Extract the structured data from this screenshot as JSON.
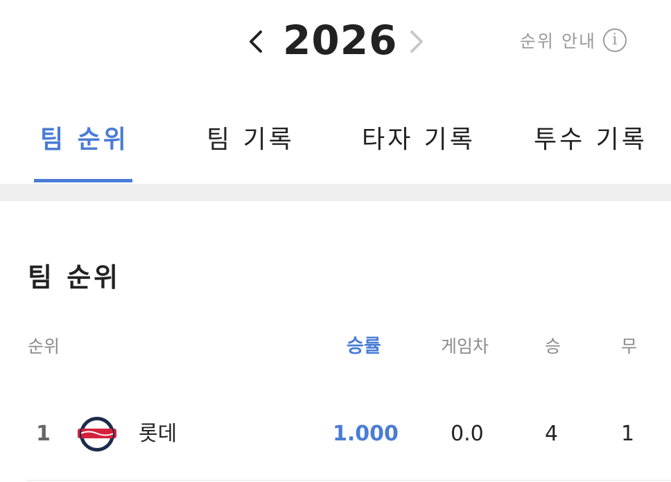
{
  "season": {
    "year": "2026",
    "prev_icon": "chevron-left-icon",
    "next_icon": "chevron-right-icon",
    "guide_label": "순위 안내",
    "guide_icon_glyph": "i"
  },
  "tabs": [
    {
      "label": "팀 순위",
      "active": true
    },
    {
      "label": "팀 기록",
      "active": false
    },
    {
      "label": "타자 기록",
      "active": false
    },
    {
      "label": "투수 기록",
      "active": false
    }
  ],
  "section": {
    "title": "팀 순위"
  },
  "table": {
    "columns": {
      "rank": "순위",
      "win_rate": "승률",
      "games_behind": "게임차",
      "wins": "승",
      "draws": "무"
    },
    "sorted_column": "win_rate",
    "rows": [
      {
        "rank": "1",
        "team": "롯데",
        "logo": "giants-logo",
        "win_rate": "1.000",
        "games_behind": "0.0",
        "wins": "4",
        "draws": "1"
      }
    ]
  },
  "colors": {
    "accent": "#4a7cd6",
    "muted": "#9a9a9a",
    "separator": "#efefef"
  }
}
